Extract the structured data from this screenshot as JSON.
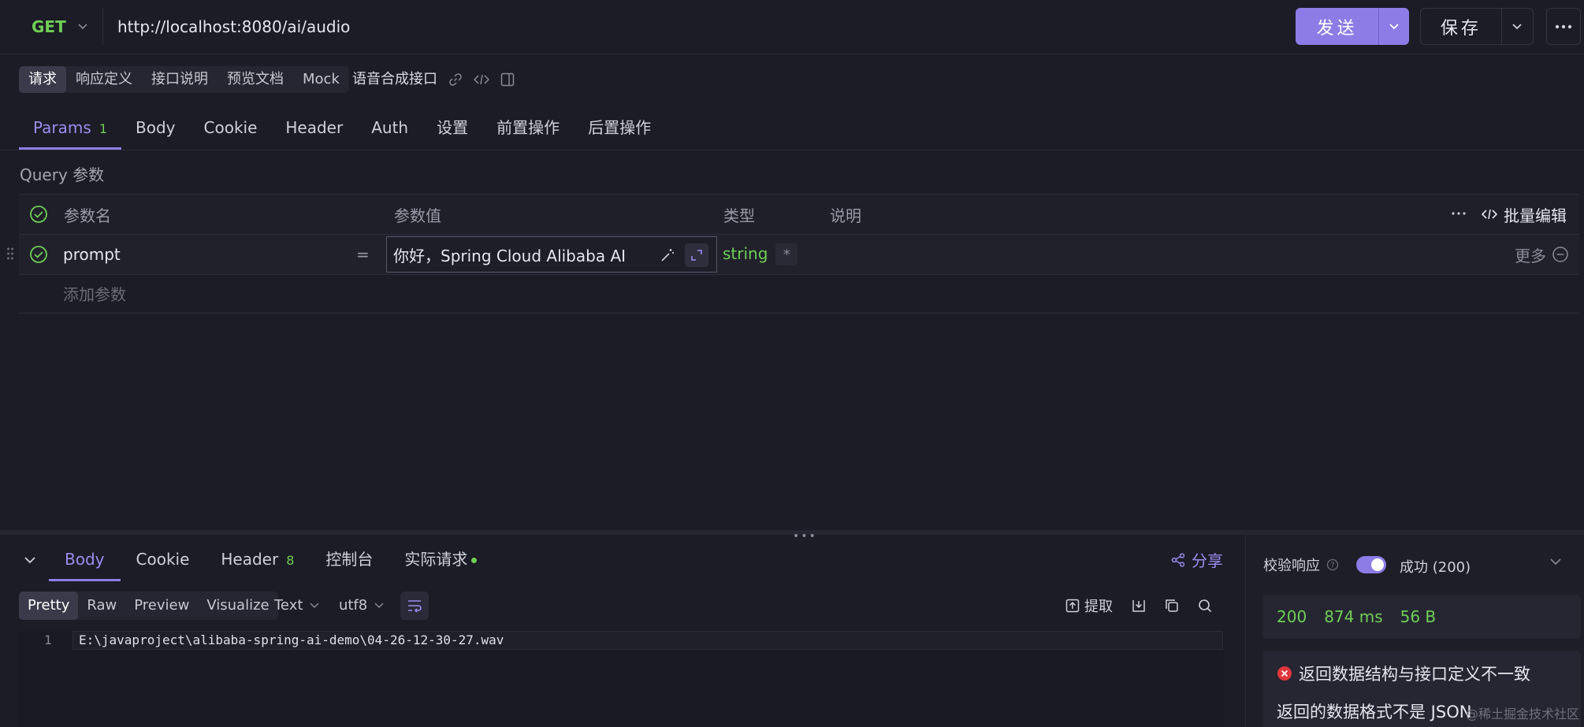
{
  "request": {
    "method": "GET",
    "url": "http://localhost:8080/ai/audio",
    "send_label": "发送",
    "save_label": "保存"
  },
  "subtabs": [
    "请求",
    "响应定义",
    "接口说明",
    "预览文档",
    "Mock"
  ],
  "api_name": "语音合成接口",
  "param_tabs": [
    {
      "label": "Params",
      "badge": "1"
    },
    {
      "label": "Body"
    },
    {
      "label": "Cookie"
    },
    {
      "label": "Header"
    },
    {
      "label": "Auth"
    },
    {
      "label": "设置"
    },
    {
      "label": "前置操作"
    },
    {
      "label": "后置操作"
    }
  ],
  "query": {
    "title": "Query 参数",
    "headers": {
      "name": "参数名",
      "value": "参数值",
      "type": "类型",
      "desc": "说明",
      "bulk_edit": "批量编辑"
    },
    "rows": [
      {
        "name": "prompt",
        "eq": "=",
        "value": "你好，Spring Cloud Alibaba AI",
        "type": "string",
        "required": "*",
        "more": "更多"
      }
    ],
    "add_placeholder": "添加参数"
  },
  "response": {
    "tabs": [
      {
        "label": "Body"
      },
      {
        "label": "Cookie"
      },
      {
        "label": "Header",
        "badge": "8"
      },
      {
        "label": "控制台"
      },
      {
        "label": "实际请求"
      }
    ],
    "share_label": "分享",
    "view_tabs": [
      "Pretty",
      "Raw",
      "Preview",
      "Visualize"
    ],
    "format": "Text",
    "encoding": "utf8",
    "extract_label": "提取",
    "line_number": "1",
    "body_line": "E:\\javaproject\\alibaba-spring-ai-demo\\04-26-12-30-27.wav"
  },
  "validation": {
    "label": "校验响应",
    "status_text": "成功 (200)",
    "enabled": true,
    "code": "200",
    "time": "874 ms",
    "size": "56 B",
    "error_title": "返回数据结构与接口定义不一致",
    "error_desc": "返回的数据格式不是 JSON"
  },
  "watermark": "@稀土掘金技术社区",
  "colors": {
    "accent": "#8d7ce6",
    "success": "#6fcf55",
    "error": "#e0363c",
    "background": "#1c1c26"
  }
}
